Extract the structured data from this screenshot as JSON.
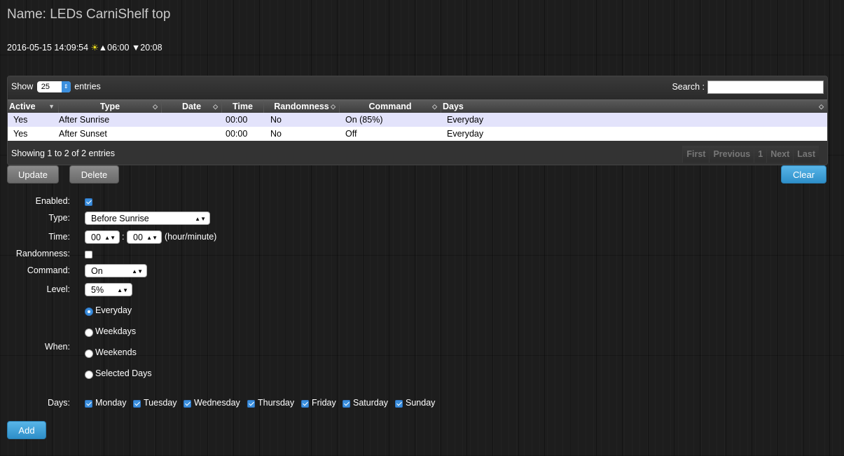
{
  "header": {
    "title": "Name: LEDs CarniShelf top",
    "datetime": "2016-05-15 14:09:54",
    "sun_icon": "☀",
    "sunrise": "▲06:00",
    "sunset": "▼20:08"
  },
  "table": {
    "show_label": "Show",
    "entries_value": "25",
    "entries_label": "entries",
    "search_label": "Search :",
    "columns": [
      "Active",
      "Type",
      "Date",
      "Time",
      "Randomness",
      "Command",
      "Days"
    ],
    "rows": [
      {
        "active": "Yes",
        "type": "After Sunrise",
        "date": "",
        "time": "00:00",
        "randomness": "No",
        "command": "On (85%)",
        "days": "Everyday"
      },
      {
        "active": "Yes",
        "type": "After Sunset",
        "date": "",
        "time": "00:00",
        "randomness": "No",
        "command": "Off",
        "days": "Everyday"
      }
    ],
    "info": "Showing 1 to 2 of 2 entries",
    "pager": {
      "first": "First",
      "previous": "Previous",
      "page": "1",
      "next": "Next",
      "last": "Last"
    }
  },
  "actions": {
    "update": "Update",
    "delete": "Delete",
    "clear": "Clear",
    "add": "Add"
  },
  "form": {
    "enabled_label": "Enabled:",
    "enabled": true,
    "type_label": "Type:",
    "type_value": "Before Sunrise",
    "time_label": "Time:",
    "hour_value": "00",
    "minute_value": "00",
    "time_sep": ":",
    "time_hint": "(hour/minute)",
    "randomness_label": "Randomness:",
    "randomness": false,
    "command_label": "Command:",
    "command_value": "On",
    "level_label": "Level:",
    "level_value": "5%",
    "when_label": "When:",
    "when_options": [
      "Everyday",
      "Weekdays",
      "Weekends",
      "Selected Days"
    ],
    "when_selected": "Everyday",
    "days_label": "Days:",
    "days": [
      "Monday",
      "Tuesday",
      "Wednesday",
      "Thursday",
      "Friday",
      "Saturday",
      "Sunday"
    ]
  },
  "colors": {
    "accent": "#3b8fde",
    "button_blue": "#3aa0d8",
    "row_highlight": "#e3e3fb"
  }
}
